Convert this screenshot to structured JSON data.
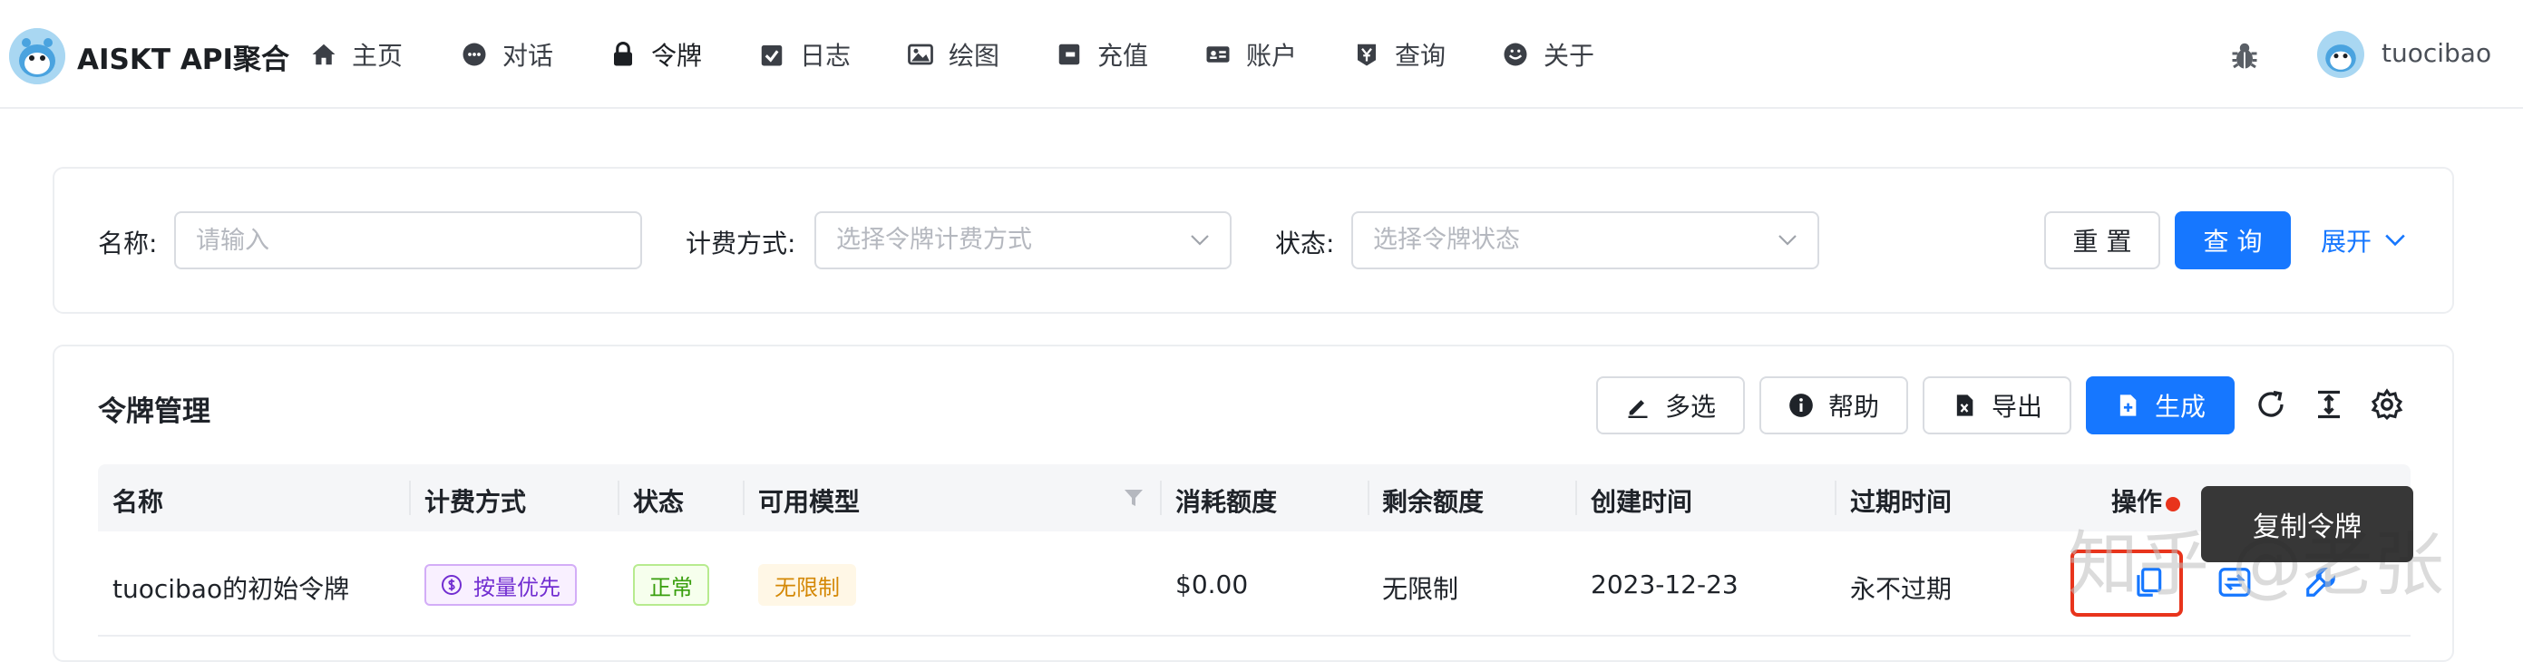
{
  "header": {
    "brand": "AISKT API聚合",
    "nav": [
      {
        "label": "主页",
        "icon": "home-icon"
      },
      {
        "label": "对话",
        "icon": "chat-icon"
      },
      {
        "label": "令牌",
        "icon": "lock-icon"
      },
      {
        "label": "日志",
        "icon": "calendar-check-icon"
      },
      {
        "label": "绘图",
        "icon": "image-icon"
      },
      {
        "label": "充值",
        "icon": "wallet-icon"
      },
      {
        "label": "账户",
        "icon": "id-card-icon"
      },
      {
        "label": "查询",
        "icon": "yen-icon"
      },
      {
        "label": "关于",
        "icon": "smile-icon"
      }
    ],
    "active_nav": "令牌",
    "user_name": "tuocibao"
  },
  "search": {
    "name_label": "名称:",
    "name_placeholder": "请输入",
    "billing_label": "计费方式:",
    "billing_placeholder": "选择令牌计费方式",
    "status_label": "状态:",
    "status_placeholder": "选择令牌状态",
    "reset_label": "重 置",
    "query_label": "查 询",
    "expand_label": "展开"
  },
  "table_card": {
    "title": "令牌管理",
    "toolbar": {
      "multi_select": "多选",
      "help": "帮助",
      "export": "导出",
      "generate": "生成"
    },
    "columns": [
      "名称",
      "计费方式",
      "状态",
      "可用模型",
      "消耗额度",
      "剩余额度",
      "创建时间",
      "过期时间",
      "操作"
    ],
    "rows": [
      {
        "name": "tuocibao的初始令牌",
        "billing": "按量优先",
        "status": "正常",
        "models": "无限制",
        "used": "$0.00",
        "remaining": "无限制",
        "created": "2023-12-23",
        "expires": "永不过期"
      }
    ],
    "tooltip": "复制令牌"
  },
  "watermark": "知乎 @老张",
  "colors": {
    "primary": "#1677ff",
    "highlight_red": "#e8341c",
    "tag_purple": "#722ed1",
    "tag_green": "#389e0d",
    "tag_orange": "#d48806"
  }
}
